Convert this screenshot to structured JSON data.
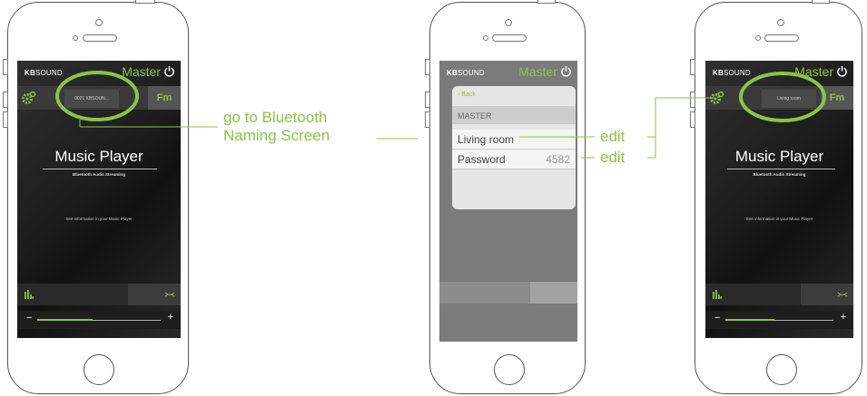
{
  "brand": {
    "logo_bold": "KB",
    "logo_rest": "SOUND"
  },
  "header": {
    "master_label": "Master"
  },
  "screens": {
    "left": {
      "device_name": "0021 KBSOUN...",
      "fm_label": "Fm",
      "title": "Music Player",
      "subtitle": "Bluetooth Audio Streaming",
      "info": "See information in your Music Player",
      "volume": {
        "minus": "−",
        "plus": "+",
        "level": 0.45
      }
    },
    "middle": {
      "back_label": "Back",
      "section_label": "MASTER",
      "rows": [
        {
          "label": "Living room",
          "value": ""
        },
        {
          "label": "Password",
          "value": "4582"
        }
      ]
    },
    "right": {
      "device_name": "Living room",
      "fm_label": "Fm",
      "title": "Music Player",
      "subtitle": "Bluetooth Audio Streaming",
      "info": "See information in your Music Player",
      "volume": {
        "minus": "−",
        "plus": "+",
        "level": 0.45
      }
    }
  },
  "annotations": {
    "go_to_line1": "go to Bluetooth",
    "go_to_line2": "Naming Screen",
    "edit_1": "edit",
    "edit_2": "edit"
  },
  "colors": {
    "accent": "#8bc34a",
    "dark": "#1c1c1c",
    "panel": "#e6e6e6"
  },
  "icons": [
    "power-icon",
    "gear-icon",
    "equalizer-icon",
    "bluetooth-arrows-icon",
    "back-chevron-icon"
  ]
}
